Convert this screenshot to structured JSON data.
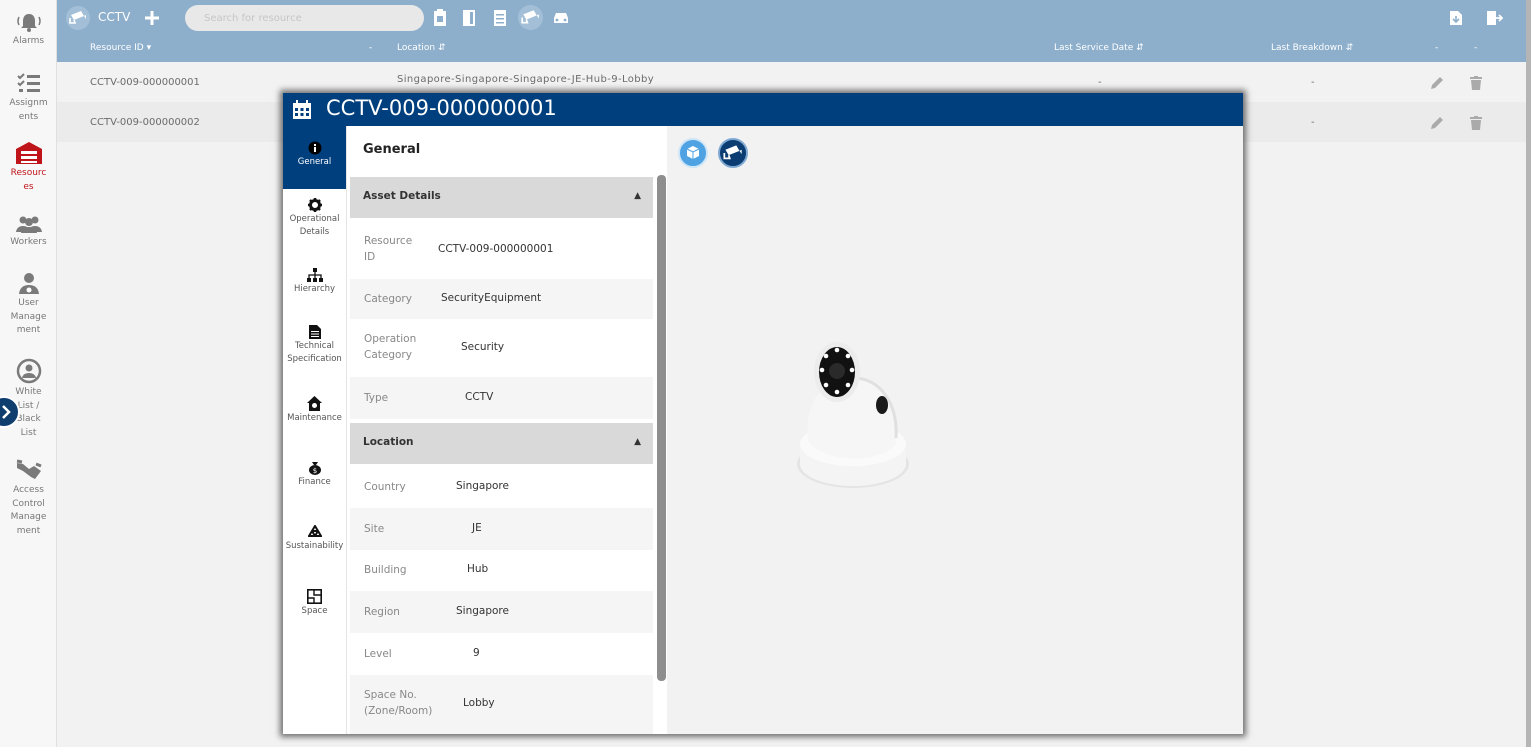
{
  "nav": {
    "items": [
      {
        "label": "Alarms",
        "icon": "alarm-bell-icon"
      },
      {
        "label": "Assignm ents",
        "icon": "checklist-icon"
      },
      {
        "label": "Resourc es",
        "icon": "warehouse-icon",
        "active": true
      },
      {
        "label": "Workers",
        "icon": "workers-icon"
      },
      {
        "label": "User Manage ment",
        "icon": "user-manage-icon"
      },
      {
        "label": "White List / Black List",
        "icon": "whitelist-icon"
      },
      {
        "label": "Access Control Manage ment",
        "icon": "handshake-icon"
      }
    ]
  },
  "topbar": {
    "title": "CCTV",
    "search_placeholder": "Search for resource"
  },
  "table": {
    "headers": {
      "resource_id": "Resource ID",
      "dash1": "-",
      "location": "Location",
      "last_service": "Last Service Date",
      "last_breakdown": "Last Breakdown",
      "dash2": "-",
      "dash3": "-"
    },
    "rows": [
      {
        "id": "CCTV-009-000000001",
        "location": "Singapore-Singapore-Singapore-JE-Hub-9-Lobby",
        "last_service": "-",
        "last_breakdown": "-"
      },
      {
        "id": "CCTV-009-000000002",
        "location": "",
        "last_service": "",
        "last_breakdown": "-"
      }
    ]
  },
  "modal": {
    "title": "CCTV-009-000000001",
    "tabs": [
      "General",
      "Operational Details",
      "Hierarchy",
      "Technical Specification",
      "Maintenance",
      "Finance",
      "Sustainability",
      "Space"
    ],
    "panel_title": "General",
    "asset_section": "Asset Details",
    "asset_fields": [
      {
        "label": "Resource ID",
        "value": "CCTV-009-000000001"
      },
      {
        "label": "Category",
        "value": "SecurityEquipment"
      },
      {
        "label": "Operation Category",
        "value": "Security"
      },
      {
        "label": "Type",
        "value": "CCTV"
      }
    ],
    "location_section": "Location",
    "location_fields": [
      {
        "label": "Country",
        "value": "Singapore"
      },
      {
        "label": "Site",
        "value": "JE"
      },
      {
        "label": "Building",
        "value": "Hub"
      },
      {
        "label": "Region",
        "value": "Singapore"
      },
      {
        "label": "Level",
        "value": "9"
      },
      {
        "label": "Space No. (Zone/Room)",
        "value": "Lobby"
      }
    ]
  },
  "colors": {
    "header_blue": "#8dafcc",
    "modal_blue": "#003f7d",
    "active_red": "#c0141b"
  }
}
